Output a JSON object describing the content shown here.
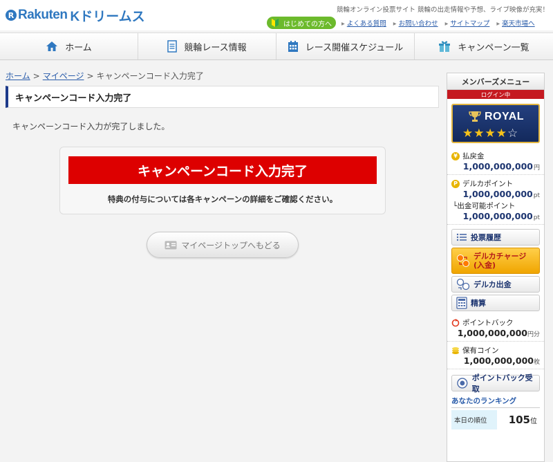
{
  "header": {
    "logo_text": "Rakuten",
    "logo_sub": "Kドリームス",
    "tagline": "競輪オンライン投票サイト 競輪の出走情報や予想、ライブ映像が充実！",
    "beginner_label": "はじめての方へ",
    "links": [
      "よくある質問",
      "お問い合わせ",
      "サイトマップ",
      "楽天市場へ"
    ]
  },
  "nav": {
    "home": "ホーム",
    "race_info": "競輪レース情報",
    "schedule": "レース開催スケジュール",
    "campaigns": "キャンペーン一覧"
  },
  "breadcrumb": {
    "home": "ホーム",
    "mypage": "マイページ",
    "current": "キャンペーンコード入力完了",
    "separator": ">"
  },
  "page": {
    "title": "キャンペーンコード入力完了",
    "lead": "キャンペーンコード入力が完了しました。",
    "banner": "キャンペーンコード入力完了",
    "note": "特典の付与については各キャンペーンの詳細をご確認ください。",
    "back_button": "マイページトップへもどる"
  },
  "sidebar": {
    "title": "メンバーズメニュー",
    "login_status": "ログイン中",
    "rank": {
      "name": "ROYAL",
      "stars_filled": 4,
      "stars_total": 5
    },
    "payout": {
      "label": "払戻金",
      "value": "1,000,000,000",
      "unit": "円"
    },
    "delca_points": {
      "label": "デルカポイント",
      "value": "1,000,000,000",
      "unit": "pt"
    },
    "withdrawable": {
      "label": "└出金可能ポイント",
      "value": "1,000,000,000",
      "unit": "pt"
    },
    "buttons": {
      "history": "投票履歴",
      "charge": "デルカチャージ\n(入金)",
      "withdraw": "デルカ出金",
      "settle": "精算",
      "pointback_receive": "ポイントバック受取"
    },
    "pointback": {
      "label": "ポイントバック",
      "value": "1,000,000,000",
      "unit": "円分"
    },
    "coins": {
      "label": "保有コイン",
      "value": "1,000,000,000",
      "unit": "枚"
    },
    "ranking": {
      "title": "あなたのランキング",
      "today_label": "本日の順位",
      "value": "105",
      "unit": "位"
    }
  },
  "colors": {
    "brand": "#2f78c0",
    "accent_red": "#dd0000",
    "navy": "#1d3570"
  }
}
